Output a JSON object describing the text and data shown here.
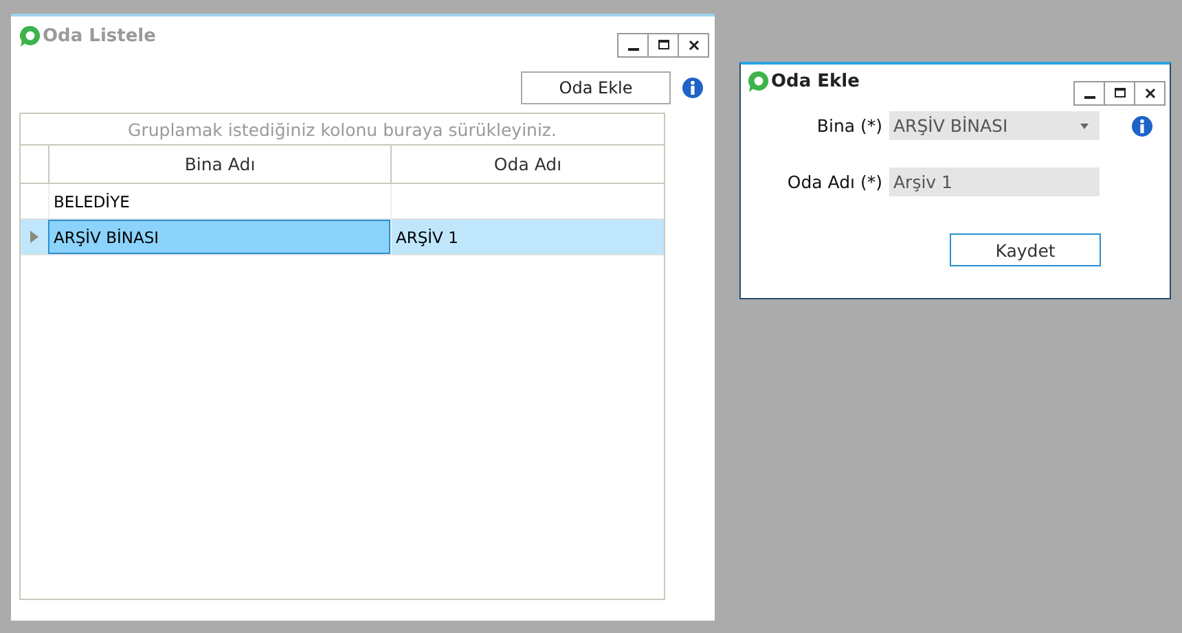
{
  "list_window": {
    "title": "Oda Listele",
    "add_button": "Oda Ekle",
    "group_panel": "Gruplamak istediğiniz kolonu buraya sürükleyiniz.",
    "columns": [
      "Bina Adı",
      "Oda Adı"
    ],
    "rows": [
      {
        "cells": [
          "BELEDİYE",
          ""
        ],
        "selected": false
      },
      {
        "cells": [
          "ARŞİV BİNASI",
          "ARŞİV 1"
        ],
        "selected": true
      }
    ]
  },
  "add_window": {
    "title": "Oda Ekle",
    "fields": [
      {
        "kind": "combo",
        "label": "Bina (*)",
        "value": "ARŞİV BİNASI"
      },
      {
        "kind": "text",
        "label": "Oda Adı (*)",
        "value": "Arşiv 1"
      }
    ],
    "save_button": "Kaydet"
  }
}
